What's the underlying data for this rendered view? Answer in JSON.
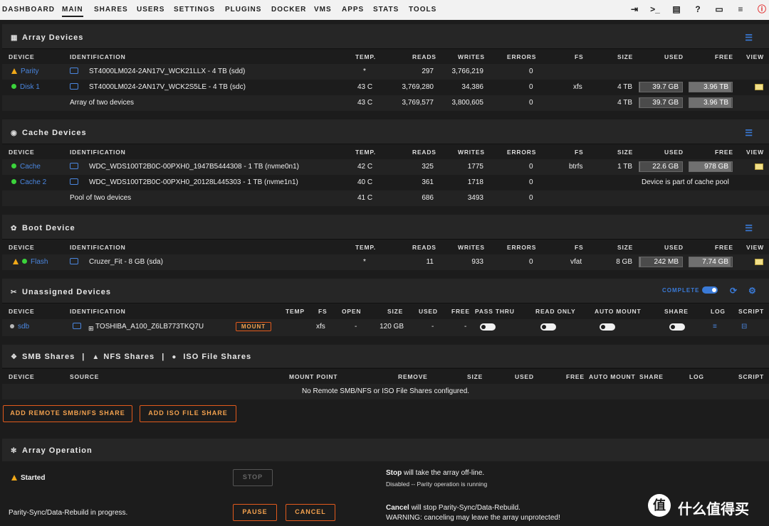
{
  "nav": {
    "tabs": [
      "DASHBOARD",
      "MAIN",
      "SHARES",
      "USERS",
      "SETTINGS",
      "PLUGINS",
      "DOCKER",
      "VMS",
      "APPS",
      "STATS",
      "TOOLS"
    ],
    "active": "MAIN"
  },
  "array": {
    "title": "Array Devices",
    "headers": {
      "device": "DEVICE",
      "identification": "IDENTIFICATION",
      "temp": "TEMP.",
      "reads": "READS",
      "writes": "WRITES",
      "errors": "ERRORS",
      "fs": "FS",
      "size": "SIZE",
      "used": "USED",
      "free": "FREE",
      "view": "VIEW"
    },
    "rows": [
      {
        "device": "Parity",
        "id": "ST4000LM024-2AN17V_WCK21LLX - 4 TB (sdd)",
        "temp": "*",
        "reads": "297",
        "writes": "3,766,219",
        "errors": "0",
        "fs": "",
        "size": "",
        "used": "",
        "free": ""
      },
      {
        "device": "Disk 1",
        "id": "ST4000LM024-2AN17V_WCK2S5LE - 4 TB (sdc)",
        "temp": "43 C",
        "reads": "3,769,280",
        "writes": "34,386",
        "errors": "0",
        "fs": "xfs",
        "size": "4 TB",
        "used": "39.7 GB",
        "free": "3.96 TB",
        "used_frac": 0.01,
        "free_frac": 0.99
      }
    ],
    "summary": {
      "label": "Array of two devices",
      "temp": "43 C",
      "reads": "3,769,577",
      "writes": "3,800,605",
      "errors": "0",
      "size": "4 TB",
      "used": "39.7 GB",
      "free": "3.96 TB"
    }
  },
  "cache": {
    "title": "Cache Devices",
    "rows": [
      {
        "device": "Cache",
        "id": "WDC_WDS100T2B0C-00PXH0_1947B5444308 - 1 TB (nvme0n1)",
        "temp": "42 C",
        "reads": "325",
        "writes": "1775",
        "errors": "0",
        "fs": "btrfs",
        "size": "1 TB",
        "used": "22.6 GB",
        "free": "978 GB",
        "used_frac": 0.02,
        "free_frac": 0.98
      },
      {
        "device": "Cache 2",
        "id": "WDC_WDS100T2B0C-00PXH0_20128L445303 - 1 TB (nvme1n1)",
        "temp": "40 C",
        "reads": "361",
        "writes": "1718",
        "errors": "0",
        "pool_note": "Device is part of cache pool"
      }
    ],
    "summary": {
      "label": "Pool of two devices",
      "temp": "41 C",
      "reads": "686",
      "writes": "3493",
      "errors": "0"
    }
  },
  "boot": {
    "title": "Boot Device",
    "row": {
      "device": "Flash",
      "id": "Cruzer_Fit - 8 GB (sda)",
      "temp": "*",
      "reads": "11",
      "writes": "933",
      "errors": "0",
      "fs": "vfat",
      "size": "8 GB",
      "used": "242 MB",
      "free": "7.74 GB",
      "used_frac": 0.03,
      "free_frac": 0.97
    }
  },
  "unassigned": {
    "title": "Unassigned Devices",
    "complete_label": "COMPLETE",
    "headers": {
      "device": "DEVICE",
      "identification": "IDENTIFICATION",
      "temp": "TEMP",
      "fs": "FS",
      "open": "OPEN",
      "size": "SIZE",
      "used": "USED",
      "free": "FREE",
      "pass_thru": "PASS THRU",
      "read_only": "READ ONLY",
      "auto_mount": "AUTO MOUNT",
      "share": "SHARE",
      "log": "LOG",
      "script": "SCRIPT"
    },
    "row": {
      "device": "sdb",
      "id": "TOSHIBA_A100_Z6LB773TKQ7U",
      "mount": "MOUNT",
      "fs": "xfs",
      "open": "-",
      "size": "120 GB",
      "used": "-",
      "free": "-"
    }
  },
  "shares": {
    "smb": "SMB Shares",
    "nfs": "NFS Shares",
    "iso": "ISO File Shares",
    "sep": "|",
    "headers": {
      "device": "DEVICE",
      "source": "SOURCE",
      "mount_point": "MOUNT POINT",
      "remove": "REMOVE",
      "size": "SIZE",
      "used": "USED",
      "free": "FREE",
      "auto_mount": "AUTO MOUNT",
      "share": "SHARE",
      "log": "LOG",
      "script": "SCRIPT"
    },
    "empty": "No Remote SMB/NFS or ISO File Shares configured.",
    "add_remote": "ADD REMOTE SMB/NFS SHARE",
    "add_iso": "ADD ISO FILE SHARE"
  },
  "operation": {
    "title": "Array Operation",
    "status": "Started",
    "stop": "STOP",
    "stop_bold": "Stop",
    "stop_desc": " will take the array off-line.",
    "stop_sub": "Disabled -- Parity operation is running",
    "progress": "Parity-Sync/Data-Rebuild in progress.",
    "pause": "PAUSE",
    "cancel": "CANCEL",
    "cancel_bold": "Cancel",
    "cancel_desc": " will stop Parity-Sync/Data-Rebuild.",
    "cancel_warn": "WARNING: canceling may leave the array unprotected!"
  },
  "watermark": {
    "logo": "值",
    "text": "什么值得买"
  }
}
